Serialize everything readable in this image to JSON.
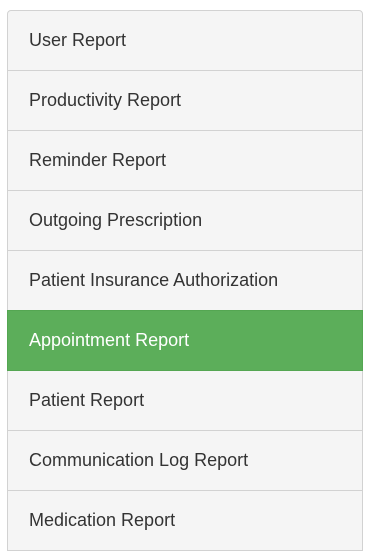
{
  "reports": {
    "items": [
      {
        "label": "User Report"
      },
      {
        "label": "Productivity Report"
      },
      {
        "label": "Reminder Report"
      },
      {
        "label": "Outgoing Prescription"
      },
      {
        "label": "Patient Insurance Authorization"
      },
      {
        "label": "Appointment Report"
      },
      {
        "label": "Patient Report"
      },
      {
        "label": "Communication Log Report"
      },
      {
        "label": "Medication Report"
      }
    ],
    "active_index": 5,
    "colors": {
      "active_background": "#5cae5a",
      "item_background": "#f5f5f5",
      "text": "#333333",
      "active_text": "#ffffff"
    }
  }
}
